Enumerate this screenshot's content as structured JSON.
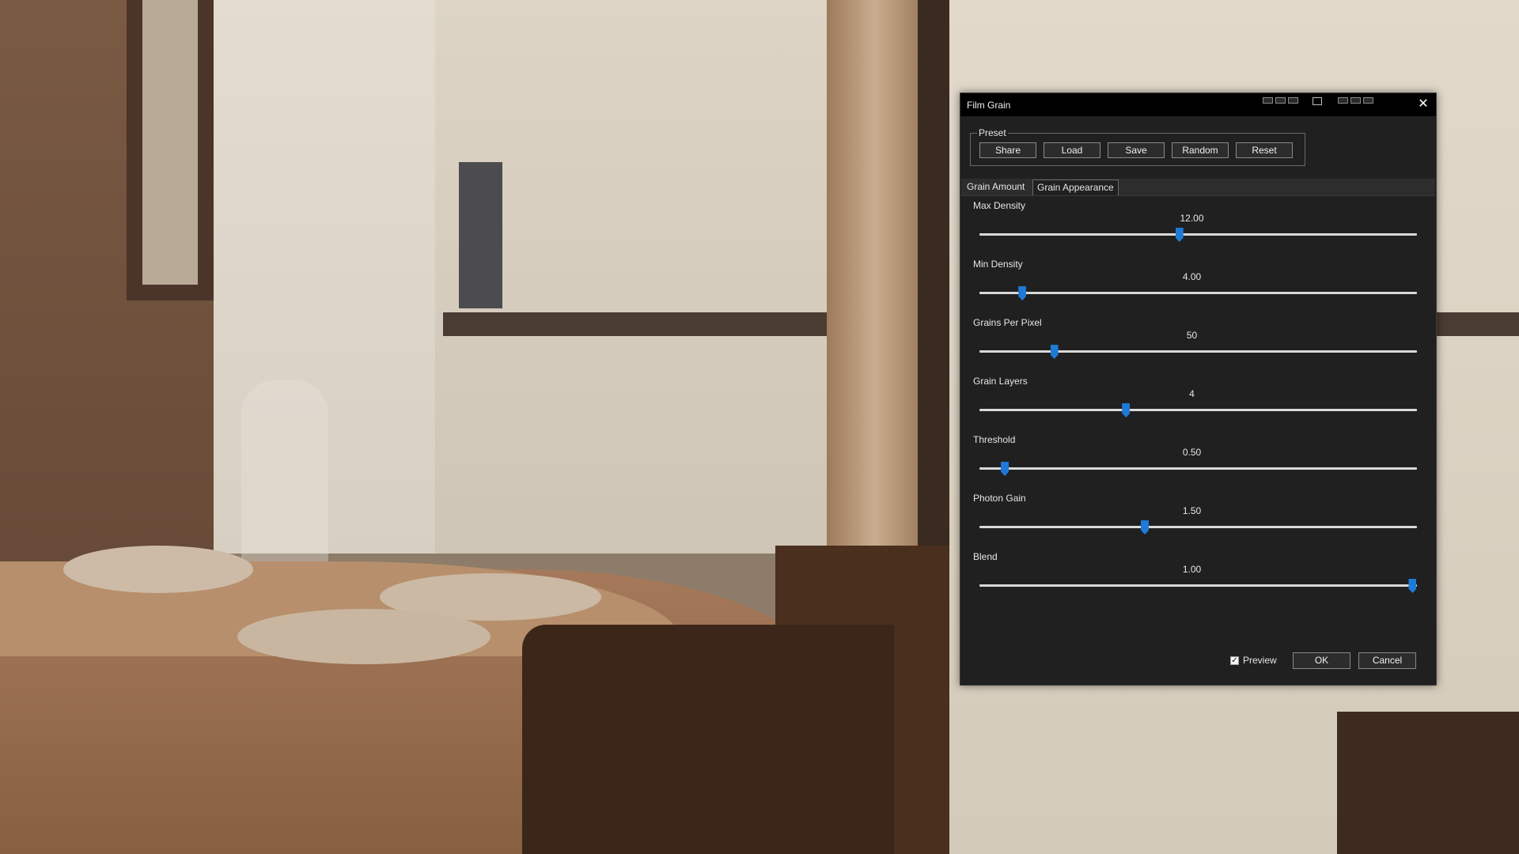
{
  "window": {
    "title": "Film Grain",
    "close_glyph": "✕"
  },
  "preset": {
    "label": "Preset",
    "buttons": [
      "Share",
      "Load",
      "Save",
      "Random",
      "Reset"
    ]
  },
  "tabs": [
    {
      "label": "Grain Amount",
      "active": false
    },
    {
      "label": "Grain Appearance",
      "active": true
    }
  ],
  "sliders": [
    {
      "label": "Max Density",
      "value_text": "12.00",
      "position_fraction": 0.457
    },
    {
      "label": "Min Density",
      "value_text": "4.00",
      "position_fraction": 0.098
    },
    {
      "label": "Grains Per Pixel",
      "value_text": "50",
      "position_fraction": 0.171
    },
    {
      "label": "Grain Layers",
      "value_text": "4",
      "position_fraction": 0.335
    },
    {
      "label": "Threshold",
      "value_text": "0.50",
      "position_fraction": 0.058
    },
    {
      "label": "Photon Gain",
      "value_text": "1.50",
      "position_fraction": 0.378
    },
    {
      "label": "Blend",
      "value_text": "1.00",
      "position_fraction": 0.99
    }
  ],
  "footer": {
    "preview_label": "Preview",
    "preview_checked": true,
    "ok_label": "OK",
    "cancel_label": "Cancel"
  },
  "colors": {
    "accent": "#1e7ad6",
    "dialog_bg": "#202020",
    "titlebar_bg": "#000000"
  }
}
